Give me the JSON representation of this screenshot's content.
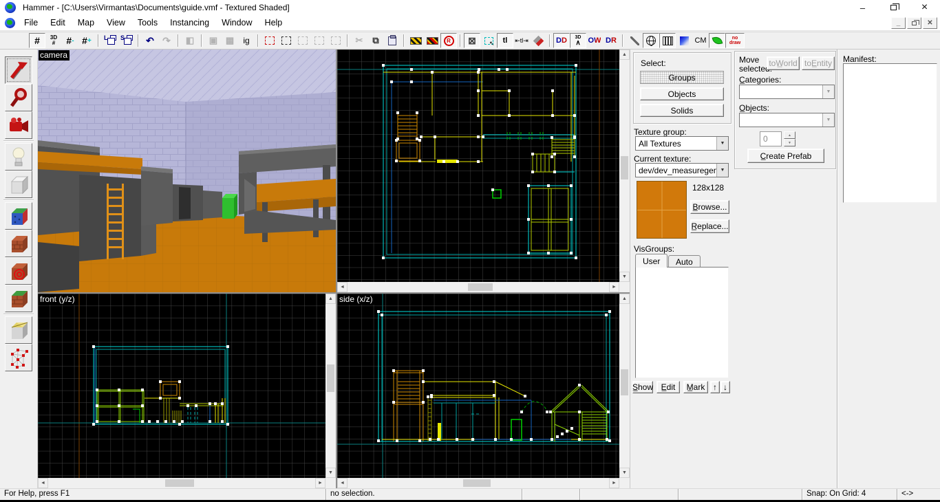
{
  "window": {
    "title": "Hammer - [C:\\Users\\Virmantas\\Documents\\guide.vmf - Textured Shaded]"
  },
  "menu": {
    "file": "File",
    "edit": "Edit",
    "map": "Map",
    "view": "View",
    "tools": "Tools",
    "instancing": "Instancing",
    "window": "Window",
    "help": "Help"
  },
  "toolbar": {
    "grid": "#",
    "grid3d": "3D",
    "grid3d_hash": "#",
    "grid_smaller": "#",
    "grid_minus": "-",
    "grid_larger": "#",
    "grid_plus": "+",
    "load_ws": "L",
    "save_ws": "S",
    "undo": "↶",
    "redo": "↷",
    "carve": "◧",
    "group": "▣",
    "ungroup": "▩",
    "ignore_groups": "ig",
    "cut": "✂",
    "copy": "⧉",
    "radius_culling": "R",
    "select_touching": "⊠",
    "select_inside": "↖",
    "texture_lock": "tl",
    "texture_scale_lock": "⇤tl⇥",
    "disp_dd": "DD",
    "disp_3d": "3D",
    "disp_3d_shape": "∧",
    "disp_ow": "OW",
    "disp_dr": "DR",
    "cm": "CM",
    "nodraw_line1": "no",
    "nodraw_line2": "draw"
  },
  "icons": {
    "min": "–",
    "close": "×",
    "scroll_up": "▲",
    "scroll_down": "▼",
    "scroll_left": "◄",
    "scroll_right": "►",
    "combo_arrow": "▼",
    "spin_up": "▲",
    "spin_down": "▼"
  },
  "viewports": {
    "camera_label": "camera",
    "front_label": "front (y/z)",
    "side_label": "side (x/z)"
  },
  "objectbar": {
    "select_label": "Select:",
    "groups": "Groups",
    "objects": "Objects",
    "solids": "Solids",
    "texture_group_label": "Texture group:",
    "texture_group_value": "All Textures",
    "current_texture_label": "Current texture:",
    "current_texture_value": "dev/dev_measuregene",
    "texture_size": "128x128",
    "browse": "B̲rowse...",
    "replace": "R̲eplace...",
    "visgroups_label": "VisGroups:",
    "tab_user": "User",
    "tab_auto": "Auto",
    "show": "S̲how",
    "edit": "E̲dit",
    "mark": "M̲ark",
    "up": "↑",
    "down": "↓"
  },
  "prefabbar": {
    "move_label": "Move selected:",
    "to_world": "toW̲orld",
    "to_entity": "toE̲ntity",
    "categories_label": "C̲ategories:",
    "objects_label": "O̲bjects:",
    "spinner_value": "0",
    "create_prefab": "C̲reate Prefab"
  },
  "manifestbar": {
    "label": "Manifest:"
  },
  "statusbar": {
    "help": "For Help, press F1",
    "selection": "no selection.",
    "snap": "Snap: On Grid: 4",
    "grid_size": "<->"
  }
}
